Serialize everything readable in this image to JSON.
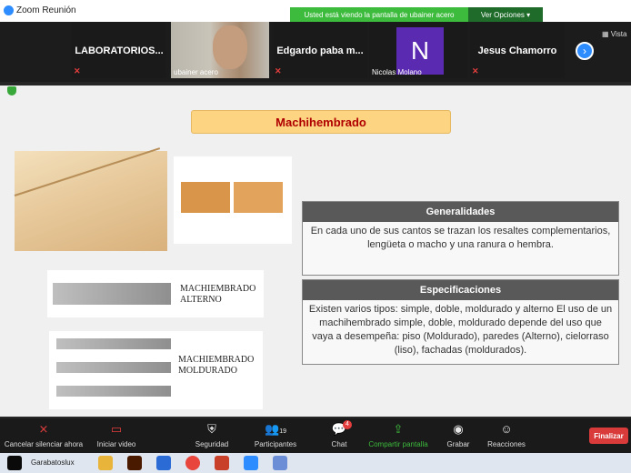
{
  "window": {
    "title": "Zoom Reunión"
  },
  "share": {
    "banner": "Usted está viendo la pantalla de ubainer acero",
    "view_options": "Ver Opciones"
  },
  "vista": "Vista",
  "participants": [
    {
      "name": "LABORATORIOS..."
    },
    {
      "name": "ubainer acero"
    },
    {
      "name": "Edgardo paba m..."
    },
    {
      "name": "Nicolas Molano",
      "initial": "N"
    },
    {
      "name": "Jesus Chamorro"
    }
  ],
  "slide": {
    "title": "Machihembrado",
    "images": [
      {
        "caption": ""
      },
      {
        "caption": ""
      },
      {
        "caption": "MACHIEMBRADO\nALTERNO"
      },
      {
        "caption": "MACHIEMBRADO\nMOLDURADO"
      }
    ],
    "generalidades": {
      "heading": "Generalidades",
      "body": "En cada uno de sus cantos se trazan los resaltes complementarios, lengüeta o macho y una ranura o hembra."
    },
    "especificaciones": {
      "heading": "Especificaciones",
      "body": "Existen varios tipos: simple, doble, moldurado y alterno El uso de un machihembrado simple, doble, moldurado depende del uso que vaya a desempeña: piso (Moldurado), paredes (Alterno), cielorraso (liso), fachadas (moldurados)."
    }
  },
  "toolbar": {
    "mute": "Cancelar silenciar ahora",
    "video": "Iniciar video",
    "security": "Seguridad",
    "participants": "Participantes",
    "participants_count": "19",
    "chat": "Chat",
    "chat_badge": "4",
    "share": "Compartir pantalla",
    "record": "Grabar",
    "reactions": "Reacciones",
    "end": "Finalizar"
  },
  "taskbar": {
    "app_label": "Garabatoslux"
  },
  "colors": {
    "share_green": "#3dbb3d",
    "end_red": "#d93b3b",
    "slide_title": "#b00000",
    "title_bg": "#fcd482",
    "header_gray": "#595959"
  }
}
